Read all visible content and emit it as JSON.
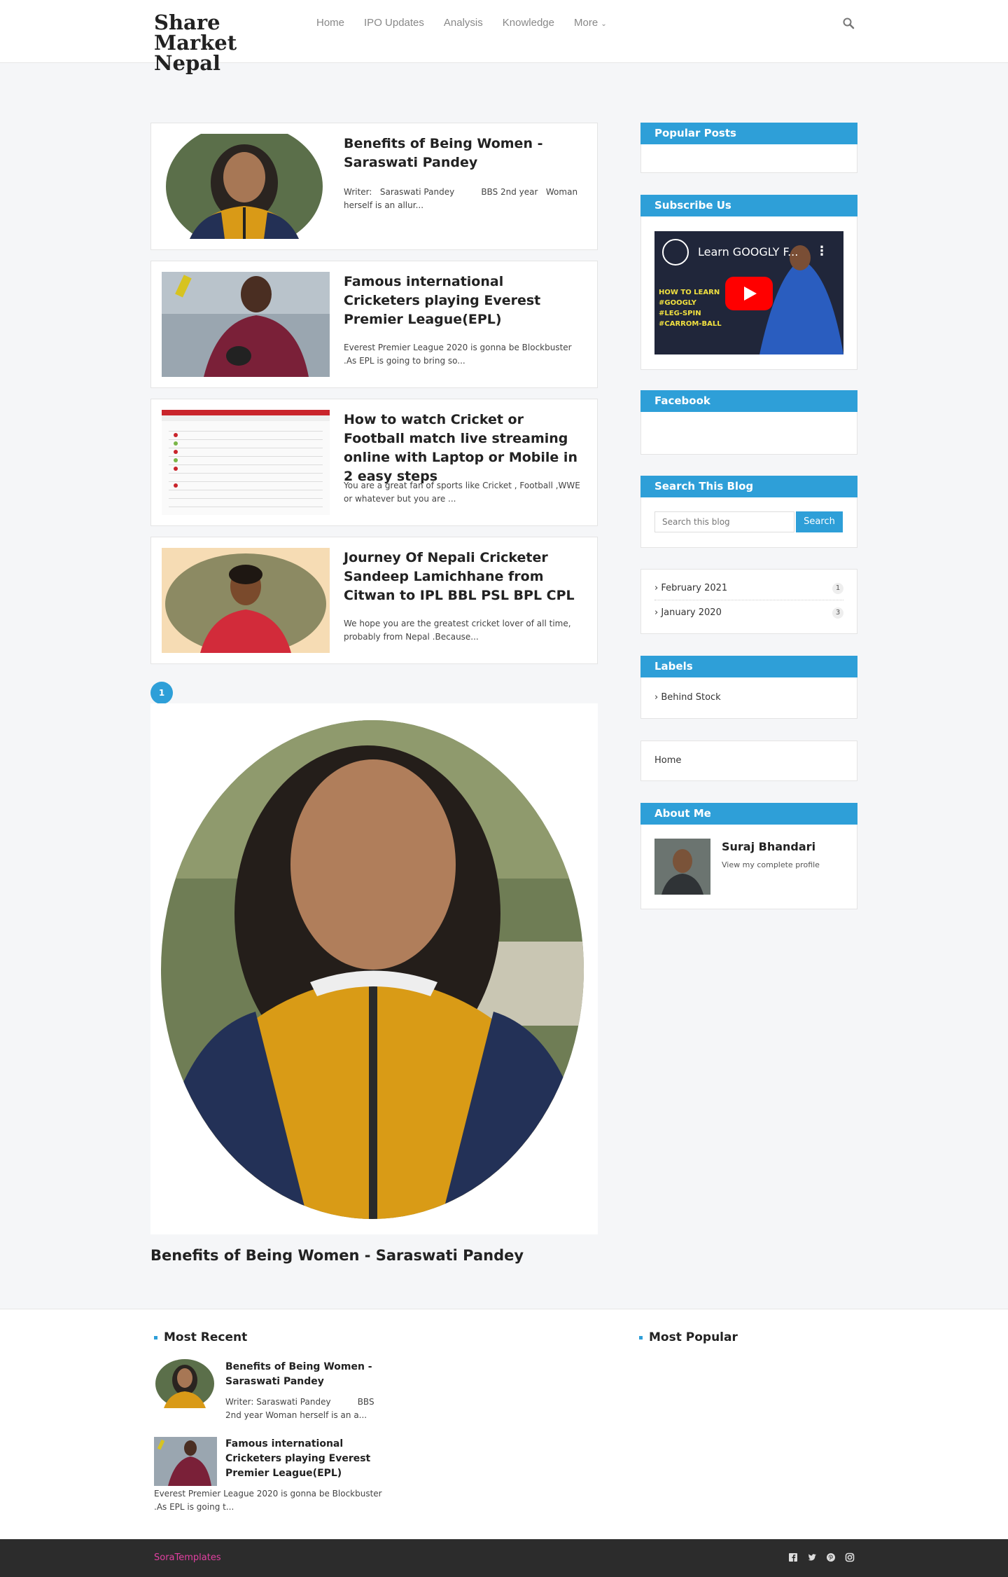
{
  "header": {
    "logo": "Share Market Nepal",
    "nav": [
      "Home",
      "IPO Updates",
      "Analysis",
      "Knowledge",
      "More"
    ]
  },
  "posts": [
    {
      "title": "Benefits of Being Women - Saraswati Pandey",
      "snippet_line1": "Writer:   Saraswati Pandey          BBS 2nd year   Woman",
      "snippet_line2": "herself is an allur..."
    },
    {
      "title": "Famous international Cricketers playing Everest Premier League(EPL)",
      "snippet": "Everest Premier League 2020 is gonna be Blockbuster .As EPL is going to bring so..."
    },
    {
      "title": "How to watch Cricket or Football match live streaming online with Laptop or Mobile in 2 easy steps",
      "snippet": "You are a great fan of sports like Cricket , Football ,WWE or whatever  but you are ..."
    },
    {
      "title": "Journey Of Nepali Cricketer Sandeep Lamichhane from Citwan to IPL BBL PSL BPL CPL",
      "snippet": "We hope you are the greatest cricket lover of all time, probably from Nepal .Because..."
    }
  ],
  "pagination": {
    "current": "1"
  },
  "featured": {
    "title": "Benefits of Being Women - Saraswati Pandey"
  },
  "sidebar": {
    "popular_posts": "Popular Posts",
    "subscribe": "Subscribe Us",
    "video_title": "Learn GOOGLY F...",
    "video_tags": [
      "HOW TO LEARN",
      "#GOOGLY",
      "#LEG-SPIN",
      "#CARROM-BALL"
    ],
    "facebook": "Facebook",
    "search_head": "Search This Blog",
    "search_placeholder": "Search this blog",
    "search_button": "Search",
    "archive": [
      {
        "label": "February 2021",
        "count": "1"
      },
      {
        "label": "January 2020",
        "count": "3"
      }
    ],
    "labels_head": "Labels",
    "label_item": "Behind Stock",
    "pages_item": "Home",
    "about_head": "About Me",
    "about_name": "Suraj Bhandari",
    "about_link": "View my complete profile"
  },
  "footer": {
    "most_recent": "Most Recent",
    "most_popular": "Most Popular",
    "recent": [
      {
        "title": "Benefits of Being Women - Saraswati Pandey",
        "text_line1": "Writer: Saraswati Pandey          BBS",
        "text_line2": "2nd year Woman herself is an a..."
      },
      {
        "title": "Famous international Cricketers playing Everest Premier League(EPL)",
        "text_line1": "Everest Premier League 2020 is gonna be Blockbuster",
        "text_line2": ".As EPL is going t..."
      }
    ],
    "credit": "SoraTemplates"
  },
  "colors": {
    "accent": "#2e9fd8",
    "footer_bg": "#2c2c2c",
    "credit": "#e040a0"
  }
}
